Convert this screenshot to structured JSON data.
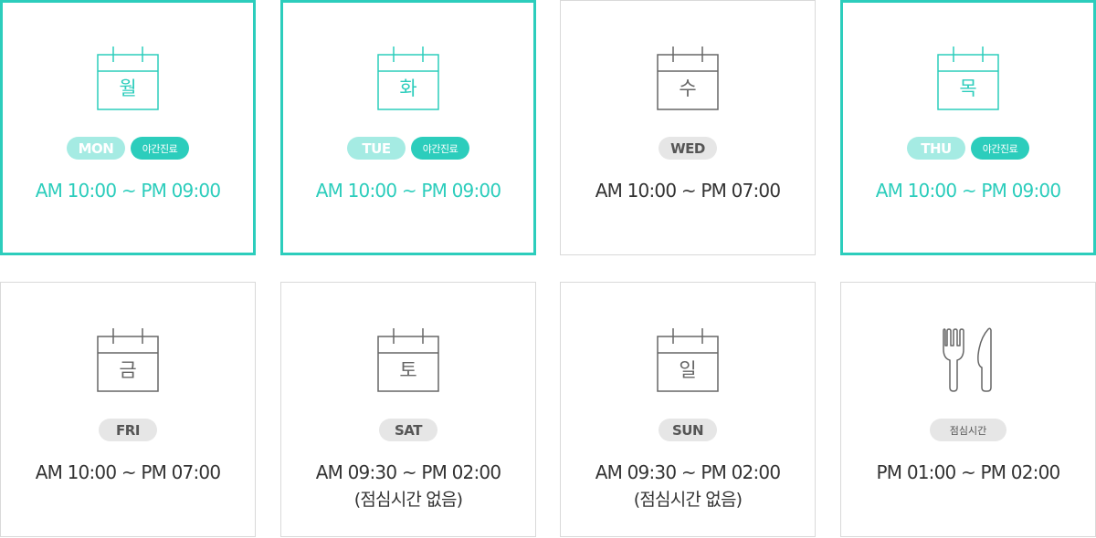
{
  "schedule": [
    {
      "day_char": "월",
      "day_code": "MON",
      "night_label": "야간진료",
      "hours": "AM 10:00 ~ PM 09:00"
    },
    {
      "day_char": "화",
      "day_code": "TUE",
      "night_label": "야간진료",
      "hours": "AM 10:00 ~ PM 09:00"
    },
    {
      "day_char": "수",
      "day_code": "WED",
      "hours": "AM 10:00 ~ PM 07:00"
    },
    {
      "day_char": "목",
      "day_code": "THU",
      "night_label": "야간진료",
      "hours": "AM 10:00 ~ PM 09:00"
    },
    {
      "day_char": "금",
      "day_code": "FRI",
      "hours": "AM 10:00 ~ PM 07:00"
    },
    {
      "day_char": "토",
      "day_code": "SAT",
      "hours": "AM 09:30 ~ PM 02:00",
      "note": "(점심시간 없음)"
    },
    {
      "day_char": "일",
      "day_code": "SUN",
      "hours": "AM 09:30 ~ PM 02:00",
      "note": "(점심시간 없음)"
    }
  ],
  "lunch": {
    "label": "점심시간",
    "hours": "PM 01:00 ~ PM 02:00",
    "icon": "utensils-icon"
  },
  "colors": {
    "accent": "#2ccdbc",
    "accent_light": "#a5ebe3",
    "gray_badge": "#e6e6e6",
    "border": "#d9d9d9",
    "text": "#333333"
  }
}
